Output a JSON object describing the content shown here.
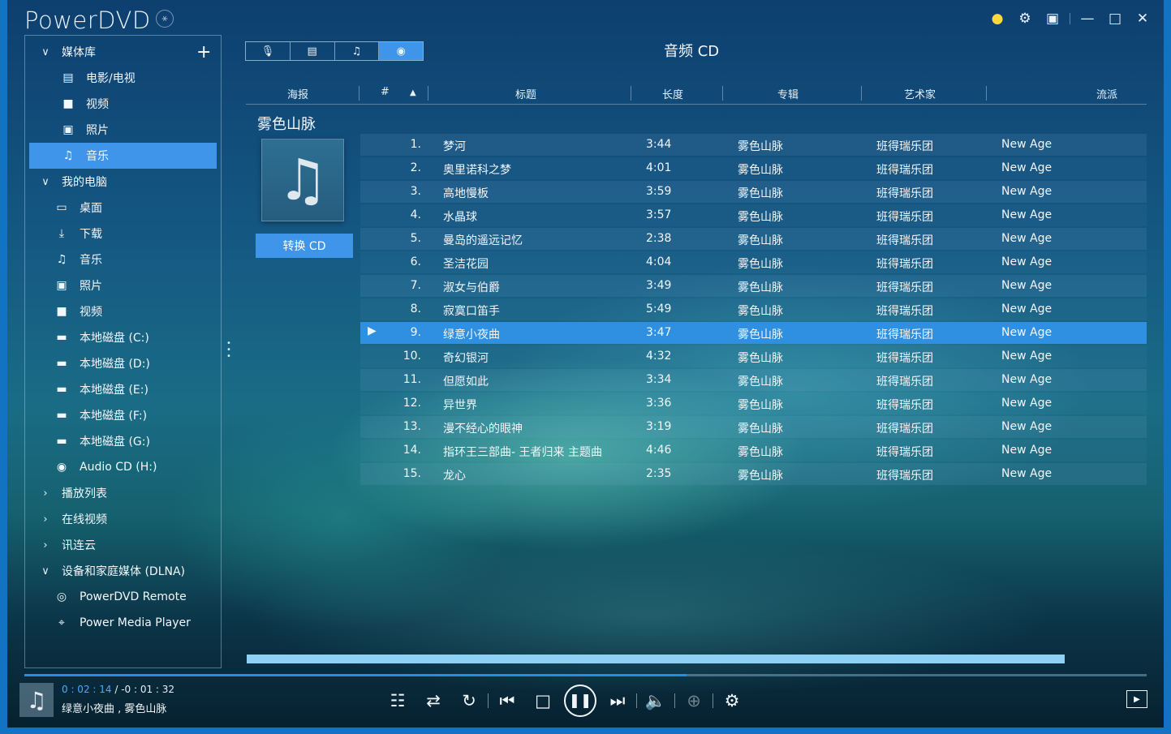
{
  "app": {
    "title": "PowerDVD"
  },
  "window_controls": {
    "icons": [
      "bulb-icon",
      "settings-icon",
      "tv-icon",
      "minimize-icon",
      "maximize-icon",
      "close-icon"
    ]
  },
  "sidebar": {
    "items": [
      {
        "label": "媒体库",
        "icon": "chevron-down-icon",
        "level": 0
      },
      {
        "label": "电影/电视",
        "icon": "film-icon",
        "level": 1
      },
      {
        "label": "视频",
        "icon": "video-icon",
        "level": 1
      },
      {
        "label": "照片",
        "icon": "photo-icon",
        "level": 1
      },
      {
        "label": "音乐",
        "icon": "music-icon",
        "level": 1,
        "active": true
      },
      {
        "label": "我的电脑",
        "icon": "chevron-down-icon",
        "level": 0
      },
      {
        "label": "桌面",
        "icon": "monitor-icon",
        "level": 2
      },
      {
        "label": "下载",
        "icon": "download-icon",
        "level": 2
      },
      {
        "label": "音乐",
        "icon": "music-icon",
        "level": 2
      },
      {
        "label": "照片",
        "icon": "photo-icon",
        "level": 2
      },
      {
        "label": "视频",
        "icon": "video-icon",
        "level": 2
      },
      {
        "label": "本地磁盘 (C:)",
        "icon": "drive-icon",
        "level": 2
      },
      {
        "label": "本地磁盘 (D:)",
        "icon": "drive-icon",
        "level": 2
      },
      {
        "label": "本地磁盘 (E:)",
        "icon": "drive-icon",
        "level": 2
      },
      {
        "label": "本地磁盘 (F:)",
        "icon": "drive-icon",
        "level": 2
      },
      {
        "label": "本地磁盘 (G:)",
        "icon": "drive-icon",
        "level": 2
      },
      {
        "label": "Audio CD (H:)",
        "icon": "disc-icon",
        "level": 2
      },
      {
        "label": "播放列表",
        "icon": "chevron-right-icon",
        "level": 0
      },
      {
        "label": "在线视频",
        "icon": "chevron-right-icon",
        "level": 0
      },
      {
        "label": "讯连云",
        "icon": "chevron-right-icon",
        "level": 0
      },
      {
        "label": "设备和家庭媒体 (DLNA)",
        "icon": "chevron-down-icon",
        "level": 0
      },
      {
        "label": "PowerDVD Remote",
        "icon": "wifi-remote-icon",
        "level": 2
      },
      {
        "label": "Power Media Player",
        "icon": "media-player-icon",
        "level": 2
      }
    ]
  },
  "view_switch": {
    "icons": [
      "microphone-icon",
      "list-icon",
      "music-note-icon",
      "disc-icon"
    ],
    "active_index": 3
  },
  "main": {
    "title": "音频 CD",
    "columns": {
      "poster": "海报",
      "number": "#",
      "title": "标题",
      "length": "长度",
      "album": "专辑",
      "artist": "艺术家",
      "genre": "流派"
    },
    "album": {
      "name": "雾色山脉",
      "convert_label": "转换 CD"
    },
    "playing_index": 8,
    "tracks": [
      {
        "num": "1.",
        "title": "梦河",
        "length": "3:44",
        "album": "雾色山脉",
        "artist": "班得瑞乐团",
        "genre": "New Age"
      },
      {
        "num": "2.",
        "title": "奥里诺科之梦",
        "length": "4:01",
        "album": "雾色山脉",
        "artist": "班得瑞乐团",
        "genre": "New Age"
      },
      {
        "num": "3.",
        "title": "高地慢板",
        "length": "3:59",
        "album": "雾色山脉",
        "artist": "班得瑞乐团",
        "genre": "New Age"
      },
      {
        "num": "4.",
        "title": "水晶球",
        "length": "3:57",
        "album": "雾色山脉",
        "artist": "班得瑞乐团",
        "genre": "New Age"
      },
      {
        "num": "5.",
        "title": "曼岛的遥远记忆",
        "length": "2:38",
        "album": "雾色山脉",
        "artist": "班得瑞乐团",
        "genre": "New Age"
      },
      {
        "num": "6.",
        "title": "圣洁花园",
        "length": "4:04",
        "album": "雾色山脉",
        "artist": "班得瑞乐团",
        "genre": "New Age"
      },
      {
        "num": "7.",
        "title": "淑女与伯爵",
        "length": "3:49",
        "album": "雾色山脉",
        "artist": "班得瑞乐团",
        "genre": "New Age"
      },
      {
        "num": "8.",
        "title": "寂寞口笛手",
        "length": "5:49",
        "album": "雾色山脉",
        "artist": "班得瑞乐团",
        "genre": "New Age"
      },
      {
        "num": "9.",
        "title": "绿意小夜曲",
        "length": "3:47",
        "album": "雾色山脉",
        "artist": "班得瑞乐团",
        "genre": "New Age"
      },
      {
        "num": "10.",
        "title": "奇幻银河",
        "length": "4:32",
        "album": "雾色山脉",
        "artist": "班得瑞乐团",
        "genre": "New Age"
      },
      {
        "num": "11.",
        "title": "但愿如此",
        "length": "3:34",
        "album": "雾色山脉",
        "artist": "班得瑞乐团",
        "genre": "New Age"
      },
      {
        "num": "12.",
        "title": "异世界",
        "length": "3:36",
        "album": "雾色山脉",
        "artist": "班得瑞乐团",
        "genre": "New Age"
      },
      {
        "num": "13.",
        "title": "漫不经心的眼神",
        "length": "3:19",
        "album": "雾色山脉",
        "artist": "班得瑞乐团",
        "genre": "New Age"
      },
      {
        "num": "14.",
        "title": "指环王三部曲- 王者归来 主题曲",
        "length": "4:46",
        "album": "雾色山脉",
        "artist": "班得瑞乐团",
        "genre": "New Age"
      },
      {
        "num": "15.",
        "title": "龙心",
        "length": "2:35",
        "album": "雾色山脉",
        "artist": "班得瑞乐团",
        "genre": "New Age"
      }
    ]
  },
  "player": {
    "elapsed": "0 : 02 : 14",
    "separator": " / ",
    "remaining": "-0 : 01 : 32",
    "now_playing": "绿意小夜曲 , 雾色山脉",
    "progress_fraction": 0.59,
    "buffer_fraction": 1.0,
    "control_icons": [
      "equalizer-icon",
      "shuffle-icon",
      "repeat-icon",
      "previous-icon",
      "stop-icon",
      "pause-icon",
      "next-icon",
      "volume-icon",
      "zoom-icon",
      "settings-icon",
      "cast-screen-icon"
    ]
  },
  "colors": {
    "accent": "#3f95ea",
    "frame": "#1273c2",
    "progress": "#1f8ef0",
    "buffer": "#8fd0f5",
    "time_current": "#4aa8ff"
  }
}
